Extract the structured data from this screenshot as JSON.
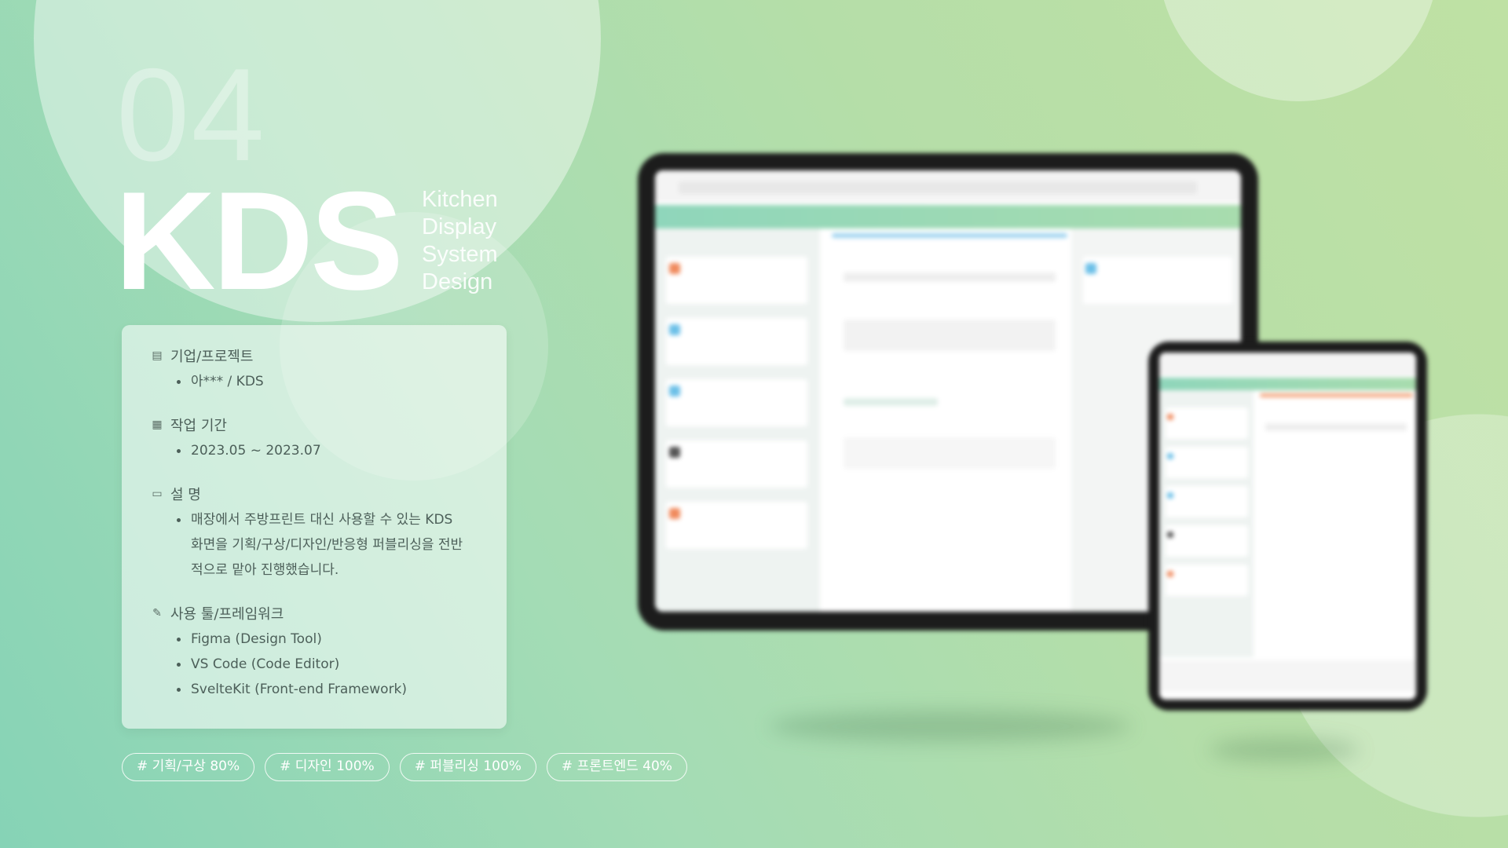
{
  "hero": {
    "number": "04",
    "title": "KDS",
    "subtitle": [
      "Kitchen",
      "Display",
      "System",
      "Design"
    ]
  },
  "info": {
    "sections": [
      {
        "icon": "building-icon",
        "heading": "기업/프로젝트",
        "items": [
          "아*** / KDS"
        ]
      },
      {
        "icon": "calendar-icon",
        "heading": "작업 기간",
        "items": [
          "2023.05 ~ 2023.07"
        ]
      },
      {
        "icon": "note-icon",
        "heading": "설 명",
        "items": [
          "매장에서 주방프린트 대신 사용할 수 있는 KDS 화면을 기획/구상/디자인/반응형 퍼블리싱을 전반적으로 맡아 진행했습니다."
        ]
      },
      {
        "icon": "pencil-icon",
        "heading": "사용 툴/프레임워크",
        "items": [
          "Figma (Design Tool)",
          "VS Code (Code Editor)",
          "SvelteKit (Front-end Framework)"
        ]
      }
    ]
  },
  "tags": [
    "# 기획/구상 80%",
    "# 디자인 100%",
    "# 퍼블리싱 100%",
    "# 프론트엔드 40%"
  ],
  "colors": {
    "accent_green": "#8fd4b5",
    "order_orange": "#f08a5d",
    "order_blue": "#6cc0e8",
    "text": "#4c5f59"
  }
}
